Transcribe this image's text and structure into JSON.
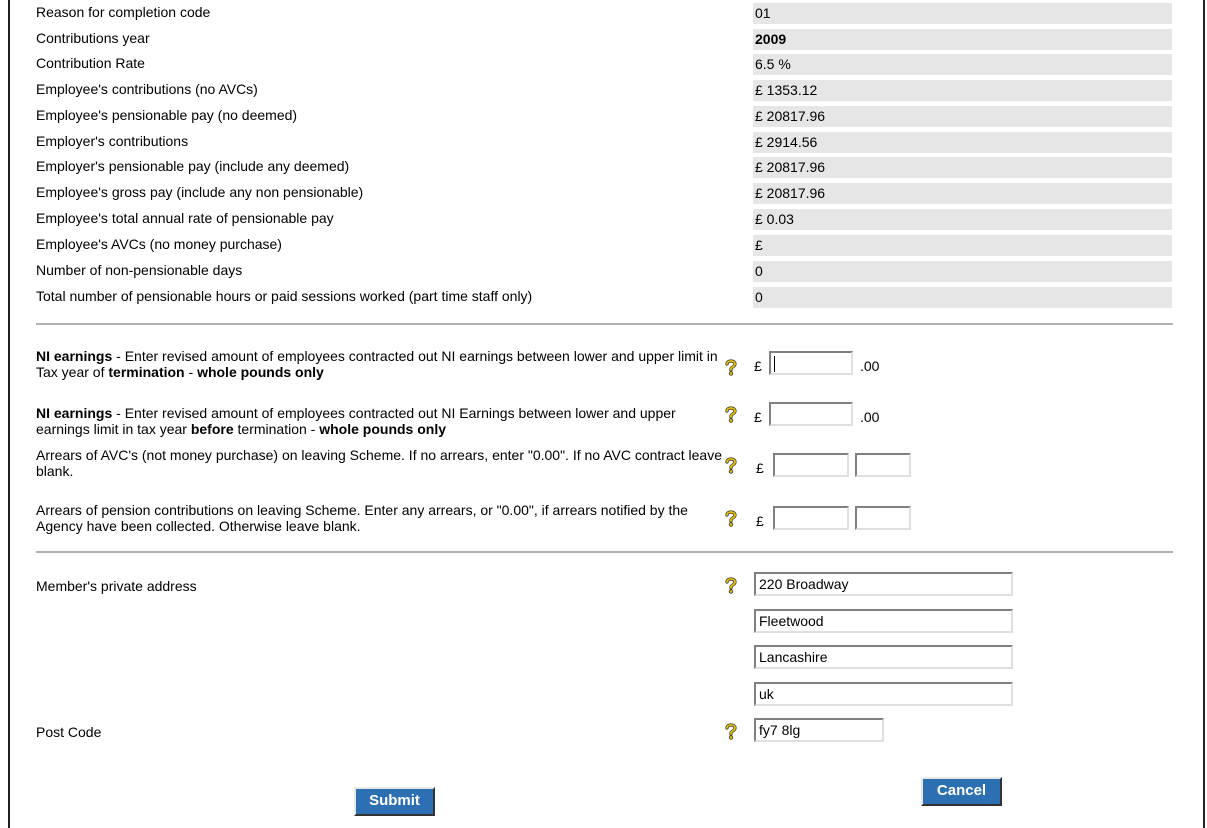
{
  "details": [
    {
      "label": "Reason for completion code",
      "value": "01"
    },
    {
      "label": "Contributions year",
      "value": "2009"
    },
    {
      "label": "Contribution Rate",
      "value": "6.5 %"
    },
    {
      "label": "Employee's contributions (no AVCs)",
      "value": "£ 1353.12"
    },
    {
      "label": "Employee's pensionable pay (no deemed)",
      "value": "£ 20817.96"
    },
    {
      "label": "Employer's contributions",
      "value": "£ 2914.56"
    },
    {
      "label": "Employer's pensionable pay (include any deemed)",
      "value": "£ 20817.96"
    },
    {
      "label": "Employee's gross pay (include any non pensionable)",
      "value": "£ 20817.96"
    },
    {
      "label": "Employee's total annual rate of pensionable pay",
      "value": "£ 0.03"
    },
    {
      "label": "Employee's AVCs (no money purchase)",
      "value": "£"
    },
    {
      "label": "Number of non-pensionable days",
      "value": "0"
    },
    {
      "label": "Total number of pensionable hours or paid sessions worked (part time staff only)",
      "value": "0"
    }
  ],
  "form": {
    "ni_termination": {
      "label_bold": "NI earnings",
      "label_part1": " - Enter revised amount of employees contracted out NI earnings between lower and upper limit in Tax year of ",
      "label_bold2": "termination",
      "label_part2": " - ",
      "label_bold3": "whole pounds only",
      "currency": "£",
      "value": "",
      "suffix": ".00"
    },
    "ni_before": {
      "label_bold": "NI earnings",
      "label_part1": " - Enter revised amount of employees contracted out NI Earnings between lower and upper earnings limit in tax year ",
      "label_bold2": "before",
      "label_part2": " termination - ",
      "label_bold3": "whole pounds only",
      "currency": "£",
      "value": "",
      "suffix": ".00"
    },
    "avc_arrears": {
      "label": "Arrears of AVC's (not money purchase) on leaving Scheme. If no arrears, enter \"0.00\". If no AVC contract leave blank.",
      "currency": "£",
      "pounds": "",
      "pence": ""
    },
    "pension_arrears": {
      "label": "Arrears of pension contributions on leaving Scheme. Enter any arrears, or \"0.00\", if arrears notified by the Agency have been collected. Otherwise leave blank.",
      "currency": "£",
      "pounds": "",
      "pence": ""
    },
    "address": {
      "label": "Member's private address",
      "line1": "220 Broadway",
      "line2": "Fleetwood",
      "line3": "Lancashire",
      "line4": "uk"
    },
    "postcode": {
      "label": "Post Code",
      "value": "fy7 8lg"
    }
  },
  "buttons": {
    "submit": "Submit",
    "cancel": "Cancel"
  },
  "colors": {
    "button_bg": "#2d6fb3",
    "value_bg": "#e6e6e6",
    "help_icon": "#e6c200"
  }
}
